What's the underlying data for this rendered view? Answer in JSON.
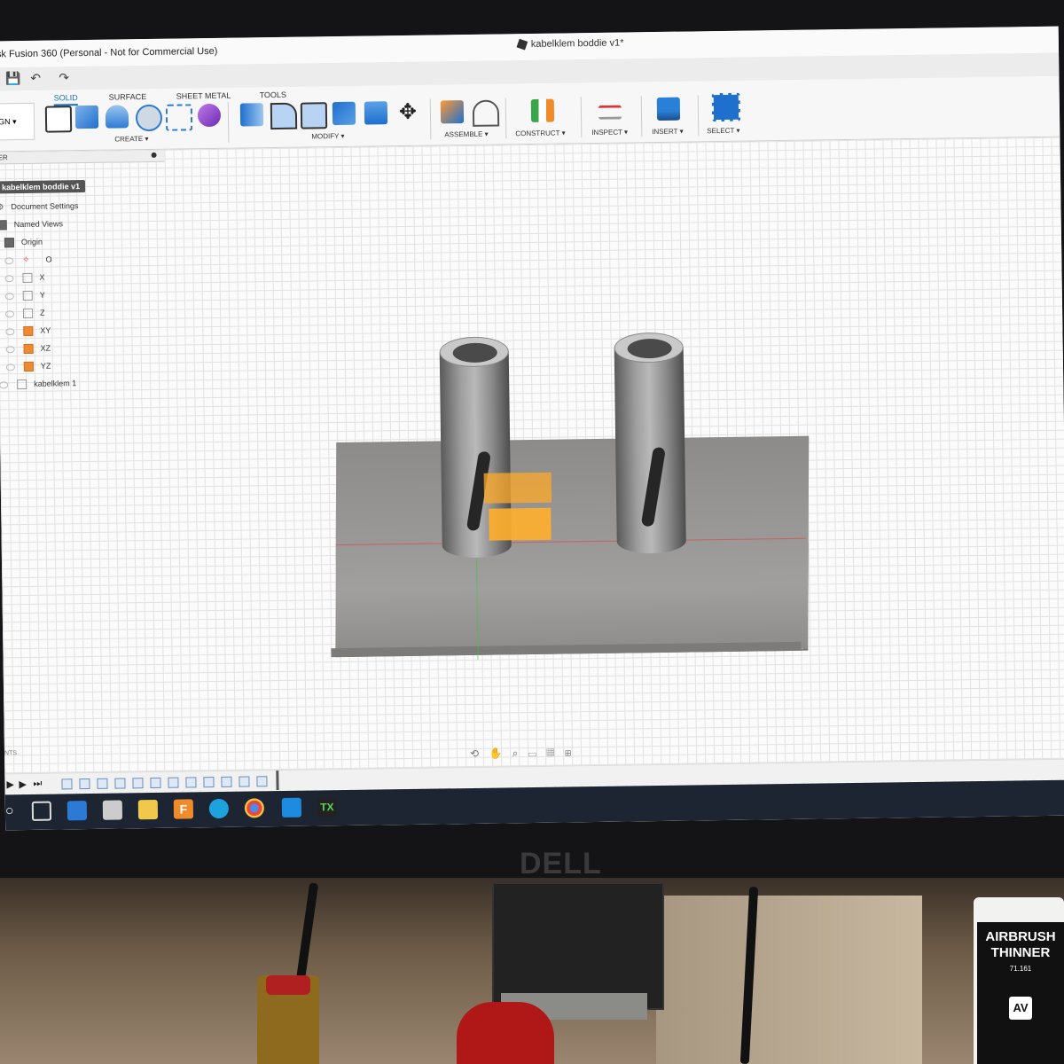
{
  "app": {
    "title": "sk Fusion 360 (Personal - Not for Commercial Use)",
    "document_tab": "kabelklem boddie v1*"
  },
  "ribbon": {
    "workspace": "GN ▾",
    "tabs": [
      "SOLID",
      "SURFACE",
      "SHEET METAL",
      "TOOLS"
    ],
    "active_tab": "SOLID",
    "groups": {
      "create": "CREATE ▾",
      "modify": "MODIFY ▾",
      "assemble": "ASSEMBLE ▾",
      "construct": "CONSTRUCT ▾",
      "inspect": "INSPECT ▾",
      "insert": "INSERT ▾",
      "select": "SELECT ▾"
    }
  },
  "browser": {
    "header": "ER",
    "root": "kabelklem boddie v1",
    "items": [
      {
        "label": "Document Settings",
        "icon": "gear-icon"
      },
      {
        "label": "Named Views",
        "icon": "folder-icon"
      },
      {
        "label": "Origin",
        "icon": "folder-icon"
      },
      {
        "label": "O",
        "icon": "origin-point-icon"
      },
      {
        "label": "X",
        "icon": "axis-icon"
      },
      {
        "label": "Y",
        "icon": "axis-icon"
      },
      {
        "label": "Z",
        "icon": "axis-icon"
      },
      {
        "label": "XY",
        "icon": "plane-icon"
      },
      {
        "label": "XZ",
        "icon": "plane-icon"
      },
      {
        "label": "YZ",
        "icon": "plane-icon"
      },
      {
        "label": "kabelklem 1",
        "icon": "component-icon"
      }
    ]
  },
  "comments_label": "NTS",
  "monitor_logo": "DELL",
  "bottle": {
    "line1": "AIRBRUSH",
    "line2": "THINNER",
    "code": "71.161",
    "brand": "AV"
  },
  "colors": {
    "accent": "#1a6fc4",
    "sketch_orange": "#ffaa28",
    "taskbar": "#1c2531"
  }
}
